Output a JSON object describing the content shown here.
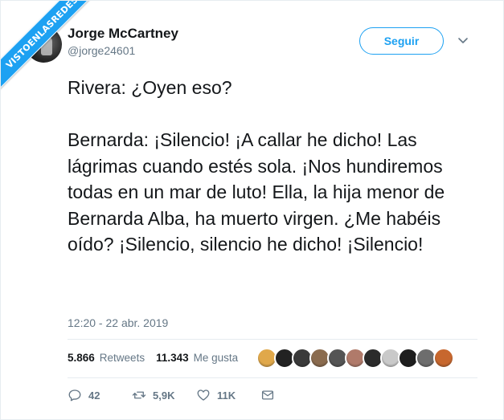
{
  "watermark": {
    "text": "VISTOENLASREDES"
  },
  "author": {
    "name": "Jorge McCartney",
    "handle": "@jorge24601"
  },
  "follow_button": {
    "label": "Seguir"
  },
  "tweet": {
    "text": "Rivera: ¿Oyen eso?\n\nBernarda: ¡Silencio! ¡A callar he dicho! Las lágrimas cuando estés sola. ¡Nos hundiremos todas en un mar de luto! Ella, la hija menor de Bernarda Alba, ha muerto virgen. ¿Me habéis oído? ¡Silencio, silencio he dicho! ¡Silencio!",
    "timestamp": "12:20 - 22 abr. 2019"
  },
  "stats": {
    "retweets_count": "5.866",
    "retweets_label": "Retweets",
    "likes_count": "11.343",
    "likes_label": "Me gusta"
  },
  "likers": [
    {
      "icon": "avatar-1",
      "color": "#e0a84a"
    },
    {
      "icon": "avatar-2",
      "color": "#222222"
    },
    {
      "icon": "avatar-3",
      "color": "#3a3a3a"
    },
    {
      "icon": "avatar-4",
      "color": "#8a6b4e"
    },
    {
      "icon": "avatar-5",
      "color": "#555555"
    },
    {
      "icon": "avatar-6",
      "color": "#b07a6a"
    },
    {
      "icon": "avatar-7",
      "color": "#2b2b2b"
    },
    {
      "icon": "avatar-8",
      "color": "#c9c9c9"
    },
    {
      "icon": "avatar-9",
      "color": "#1e1e1e"
    },
    {
      "icon": "avatar-10",
      "color": "#6d6d6d"
    },
    {
      "icon": "avatar-11",
      "color": "#c7672e"
    }
  ],
  "actions": {
    "reply_count": "42",
    "retweet_count": "5,9K",
    "like_count": "11K"
  },
  "colors": {
    "accent": "#1da1f2",
    "text": "#14171a",
    "muted": "#657786",
    "border": "#e6ecf0"
  }
}
